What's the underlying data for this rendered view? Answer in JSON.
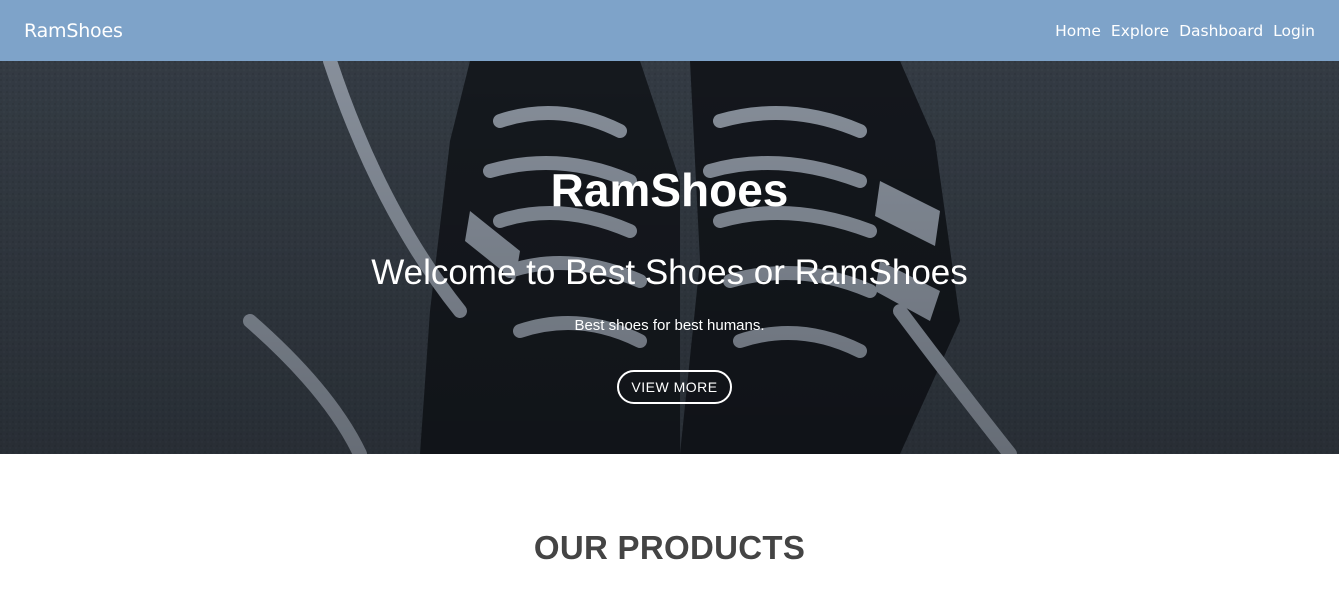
{
  "navbar": {
    "brand": "RamShoes",
    "links": [
      "Home",
      "Explore",
      "Dashboard",
      "Login"
    ]
  },
  "hero": {
    "title": "RamShoes",
    "subtitle": "Welcome to Best Shoes or RamShoes",
    "tagline": "Best shoes for best humans.",
    "button_label": "VIEW MORE",
    "background_image": "shoes-photo"
  },
  "products": {
    "heading": "OUR PRODUCTS"
  },
  "colors": {
    "navbar_bg": "#7ea3c9",
    "hero_text": "#ffffff",
    "heading_text": "#444444"
  }
}
